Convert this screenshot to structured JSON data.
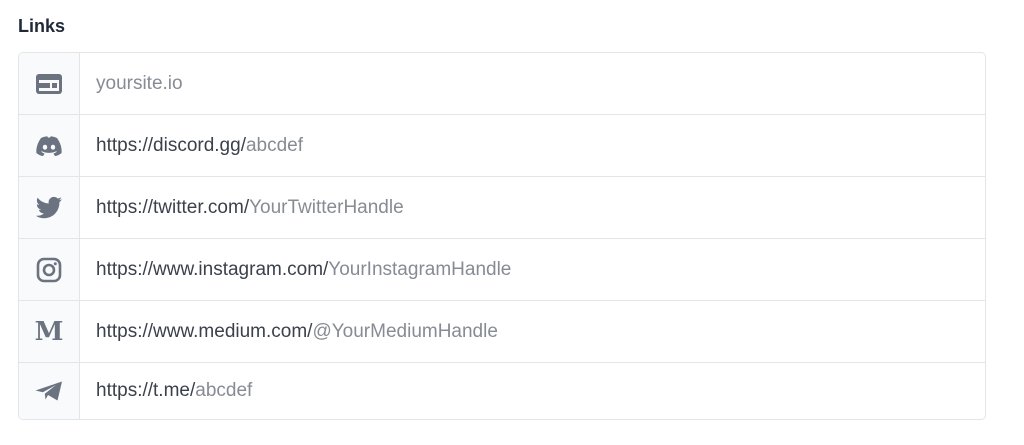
{
  "section": {
    "title": "Links"
  },
  "links": [
    {
      "icon": "website-icon",
      "prefix": "",
      "placeholder": "yoursite.io"
    },
    {
      "icon": "discord-icon",
      "prefix": "https://discord.gg/",
      "placeholder": "abcdef"
    },
    {
      "icon": "twitter-icon",
      "prefix": "https://twitter.com/",
      "placeholder": "YourTwitterHandle"
    },
    {
      "icon": "instagram-icon",
      "prefix": "https://www.instagram.com/",
      "placeholder": "YourInstagramHandle"
    },
    {
      "icon": "medium-icon",
      "prefix": "https://www.medium.com/",
      "placeholder": "@YourMediumHandle",
      "icon_glyph": "M"
    },
    {
      "icon": "telegram-icon",
      "prefix": "https://t.me/",
      "placeholder": "abcdef"
    }
  ],
  "colors": {
    "icon": "#6b7280",
    "prefix_text": "#3b414b",
    "placeholder_text": "#868b94",
    "border": "#e3e5e9",
    "icon_cell_bg": "#f9fafb"
  }
}
